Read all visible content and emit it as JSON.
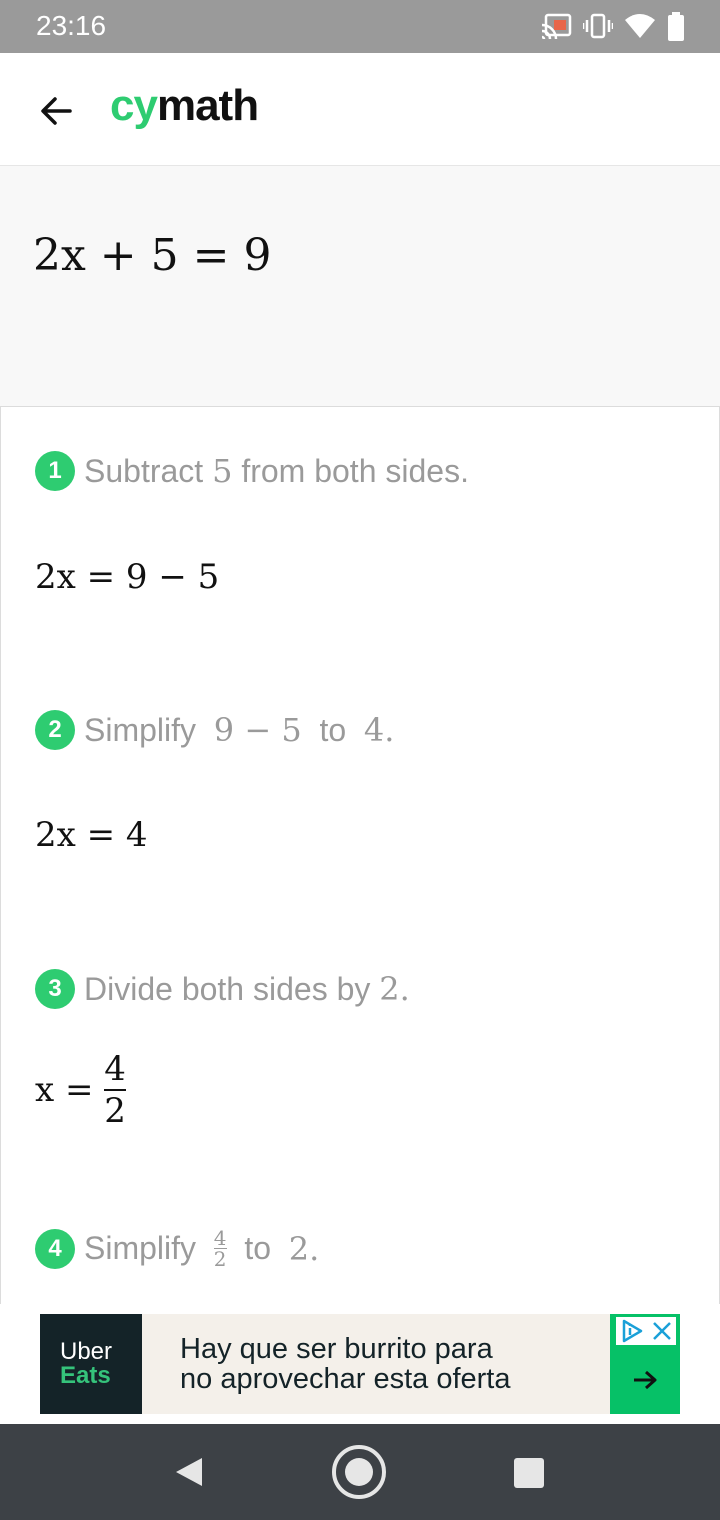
{
  "status_bar": {
    "time": "23:16"
  },
  "app": {
    "logo_cy": "cy",
    "logo_rest": "math"
  },
  "problem": {
    "expression": "2x + 5 = 9"
  },
  "steps": [
    {
      "number": "1",
      "text_before": "Subtract",
      "math_value": "5",
      "text_after": "from both sides.",
      "result": "2x = 9 − 5"
    },
    {
      "number": "2",
      "text_before": "Simplify",
      "math_from": "9 − 5",
      "text_mid": "to",
      "math_to": "4.",
      "result": "2x = 4"
    },
    {
      "number": "3",
      "text_before": "Divide both sides by",
      "math_value": "2.",
      "result_lhs": "x =",
      "result_num": "4",
      "result_den": "2"
    },
    {
      "number": "4",
      "text_before": "Simplify",
      "frac_num": "4",
      "frac_den": "2",
      "text_mid": "to",
      "math_to": "2."
    }
  ],
  "ad": {
    "brand_line1": "Uber",
    "brand_line2": "Eats",
    "text_line1": "Hay que ser burrito para",
    "text_line2": "no aprovechar esta oferta"
  },
  "colors": {
    "accent": "#2ecc71",
    "status_bar": "#9a9a9a",
    "nav_bar": "#3d4146"
  }
}
